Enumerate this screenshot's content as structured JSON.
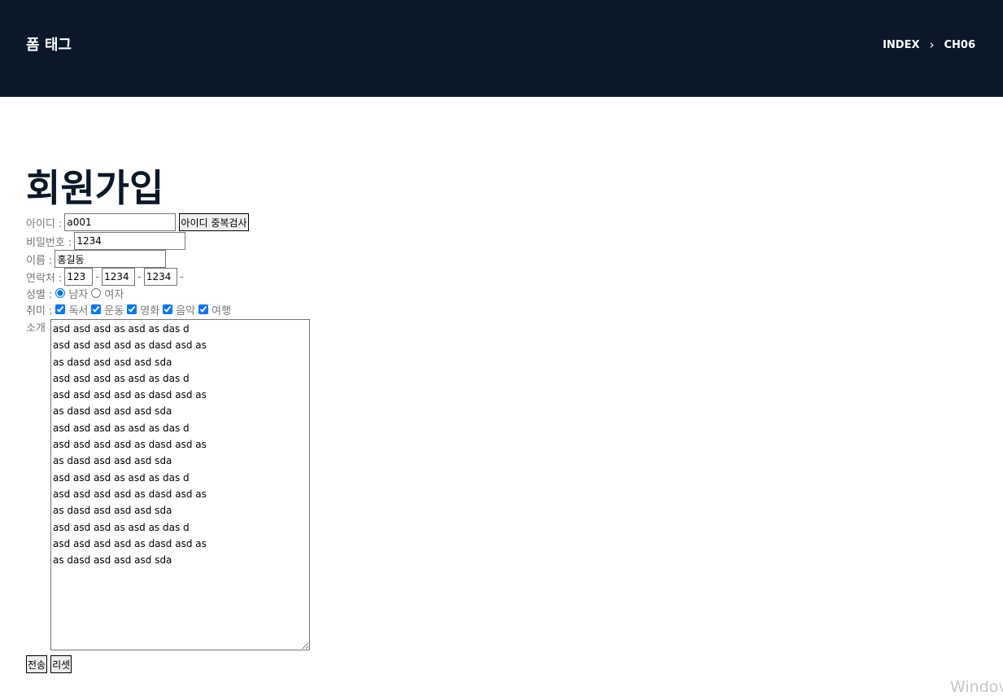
{
  "header": {
    "title": "폼 태그",
    "breadcrumb": [
      "INDEX",
      "CH06"
    ],
    "breadcrumb_sep": "›"
  },
  "form": {
    "heading": "회원가입",
    "id": {
      "label": "아이디 :",
      "value": "a001",
      "check_button": "아이디 중복검사"
    },
    "password": {
      "label": "비밀번호 :",
      "value": "1234"
    },
    "name": {
      "label": "이름 :",
      "value": "홍길동"
    },
    "phone": {
      "label": "연락처 :",
      "part1": "123",
      "part2": "1234",
      "part3": "1234",
      "sep": "-"
    },
    "gender": {
      "label": "성별 :",
      "options": [
        "남자",
        "여자"
      ],
      "selected": "남자"
    },
    "hobby": {
      "label": "취미 :",
      "options": [
        "독서",
        "운동",
        "영화",
        "음악",
        "여행"
      ],
      "checked": [
        "독서",
        "운동",
        "영화",
        "음악",
        "여행"
      ]
    },
    "intro": {
      "label": "소개",
      "text": "asd asd asd as asd as das d\nasd asd asd asd as dasd asd as\nas dasd asd asd asd sda\nasd asd asd as asd as das d\nasd asd asd asd as dasd asd as\nas dasd asd asd asd sda\nasd asd asd as asd as das d\nasd asd asd asd as dasd asd as\nas dasd asd asd asd sda\nasd asd asd as asd as das d\nasd asd asd asd as dasd asd as\nas dasd asd asd asd sda\nasd asd asd as asd as das d\nasd asd asd asd as dasd asd as\nas dasd asd asd asd sda"
    },
    "submit": "전송",
    "reset": "리셋"
  },
  "watermark": "Windov"
}
